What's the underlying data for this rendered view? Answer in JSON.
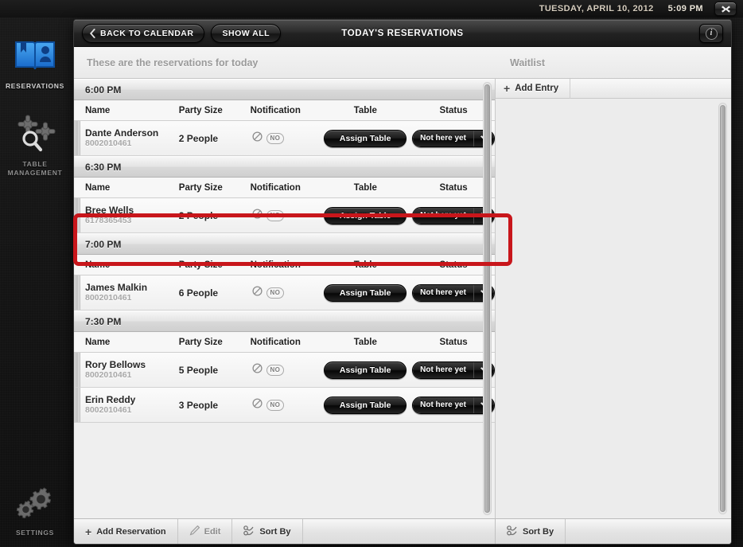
{
  "statusbar": {
    "date": "TUESDAY, APRIL 10, 2012",
    "time": "5:09 PM",
    "close_icon": "close-x-icon",
    "close_label": "✖"
  },
  "sidebar": {
    "items": [
      {
        "id": "reservations",
        "label": "RESERVATIONS",
        "icon": "open-book-person-icon",
        "active": true
      },
      {
        "id": "table-management",
        "label": "TABLE\nMANAGEMENT",
        "label_line1": "TABLE",
        "label_line2": "MANAGEMENT",
        "icon": "tables-search-icon",
        "active": false
      },
      {
        "id": "settings",
        "label": "SETTINGS",
        "icon": "gears-icon",
        "active": false
      }
    ]
  },
  "window": {
    "titlebar": {
      "back_label": "BACK TO CALENDAR",
      "back_icon": "chevron-left-icon",
      "show_all_label": "SHOW ALL",
      "title": "TODAY'S RESERVATIONS",
      "info_icon": "info-icon",
      "info_label": "i"
    },
    "subheader": {
      "left_caption": "These are the reservations for today",
      "right_caption": "Waitlist"
    }
  },
  "reservations": {
    "columns": [
      "Name",
      "Party Size",
      "Notification",
      "Table",
      "Status"
    ],
    "groups": [
      {
        "time": "6:00 PM",
        "rows": [
          {
            "name": "Dante Anderson",
            "phone": "8002010461",
            "party_size": "2 People",
            "notification_icon": "no-entry-icon",
            "notification_badge": "NO",
            "table_button": "Assign Table",
            "status": "Not here yet",
            "status_caret_icon": "chevron-down-icon",
            "highlighted": false
          }
        ]
      },
      {
        "time": "6:30 PM",
        "rows": [
          {
            "name": "Bree Wells",
            "phone": "6178365453",
            "party_size": "2 People",
            "notification_icon": "no-entry-icon",
            "notification_badge": "NO",
            "table_button": "Assign Table",
            "status": "Not here yet",
            "status_caret_icon": "chevron-down-icon",
            "highlighted": true
          }
        ]
      },
      {
        "time": "7:00 PM",
        "rows": [
          {
            "name": "James Malkin",
            "phone": "8002010461",
            "party_size": "6 People",
            "notification_icon": "no-entry-icon",
            "notification_badge": "NO",
            "table_button": "Assign Table",
            "status": "Not here yet",
            "status_caret_icon": "chevron-down-icon",
            "highlighted": false
          }
        ]
      },
      {
        "time": "7:30 PM",
        "rows": [
          {
            "name": "Rory Bellows",
            "phone": "8002010461",
            "party_size": "5 People",
            "notification_icon": "no-entry-icon",
            "notification_badge": "NO",
            "table_button": "Assign Table",
            "status": "Not here yet",
            "status_caret_icon": "chevron-down-icon",
            "highlighted": false
          },
          {
            "name": "Erin Reddy",
            "phone": "8002010461",
            "party_size": "3 People",
            "notification_icon": "no-entry-icon",
            "notification_badge": "NO",
            "table_button": "Assign Table",
            "status": "Not here yet",
            "status_caret_icon": "chevron-down-icon",
            "highlighted": false
          }
        ]
      }
    ]
  },
  "waitlist": {
    "add_entry_label": "Add Entry",
    "add_entry_icon": "plus-icon",
    "entries": []
  },
  "bottom_toolbar": {
    "left": [
      {
        "label": "Add Reservation",
        "icon": "plus-icon",
        "muted": false
      },
      {
        "label": "Edit",
        "icon": "pencil-icon",
        "muted": true
      },
      {
        "label": "Sort By",
        "icon": "sort-icon",
        "muted": false
      }
    ],
    "right": [
      {
        "label": "Sort By",
        "icon": "sort-icon",
        "muted": false
      }
    ]
  },
  "annotation": {
    "color": "#c8161b",
    "target": "Bree Wells reservation row"
  }
}
